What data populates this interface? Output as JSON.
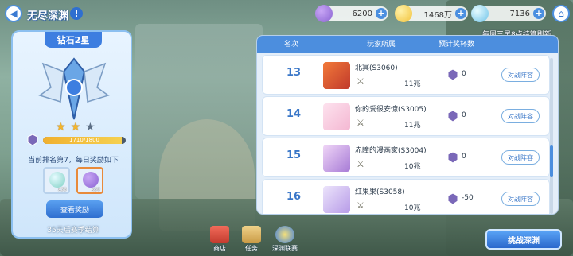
{
  "header": {
    "title": "无尽深渊",
    "back_glyph": "◀",
    "info_glyph": "!",
    "home_glyph": "⌂"
  },
  "currencies": [
    {
      "name": "purple-orb",
      "value": "6200",
      "color": "#8a63d2"
    },
    {
      "name": "gold-coin",
      "value": "1468万",
      "color": "#f2c23a"
    },
    {
      "name": "gem",
      "value": "7136",
      "color": "#6fc3e8"
    }
  ],
  "refresh_note": "每周三早8点结算刷新",
  "left_panel": {
    "rank_title": "钻石2星",
    "stars_on": 2,
    "stars_total": 3,
    "progress_text": "1710/1800",
    "progress_fraction": 0.95,
    "reward_note": "当前排名第7，每日奖励如下",
    "rewards": [
      {
        "icon": "gem-icon",
        "count": "x35",
        "color": "#7fd0c4"
      },
      {
        "icon": "orb-icon",
        "count": "x50",
        "color": "#8a63d2"
      }
    ],
    "view_button": "查看奖励",
    "season_left": "35天后赛季结算"
  },
  "table": {
    "columns": [
      "名次",
      "玩家所属",
      "预计奖杯数"
    ],
    "rows": [
      {
        "rank": "13",
        "name": "北冥(S3060)",
        "power": "11兆",
        "trophy": "0",
        "button": "对战阵容",
        "avatar_color": "#c0392b"
      },
      {
        "rank": "14",
        "name": "你的爱很安慷(S3005)",
        "power": "11兆",
        "trophy": "0",
        "button": "对战阵容",
        "avatar_color": "#f4b7d2"
      },
      {
        "rank": "15",
        "name": "赤瞳的漫画家(S3004)",
        "power": "10兆",
        "trophy": "0",
        "button": "对战阵容",
        "avatar_color": "#a77bd6"
      },
      {
        "rank": "16",
        "name": "红果果(S3058)",
        "power": "10兆",
        "trophy": "-50",
        "button": "对战阵容",
        "avatar_color": "#b79be8"
      }
    ]
  },
  "bottom": {
    "shop": "商店",
    "tasks": "任务",
    "abyss_league": "深渊联赛",
    "challenge": "挑战深渊"
  },
  "colors": {
    "accent": "#4c8ede",
    "gold": "#f4b52a"
  }
}
